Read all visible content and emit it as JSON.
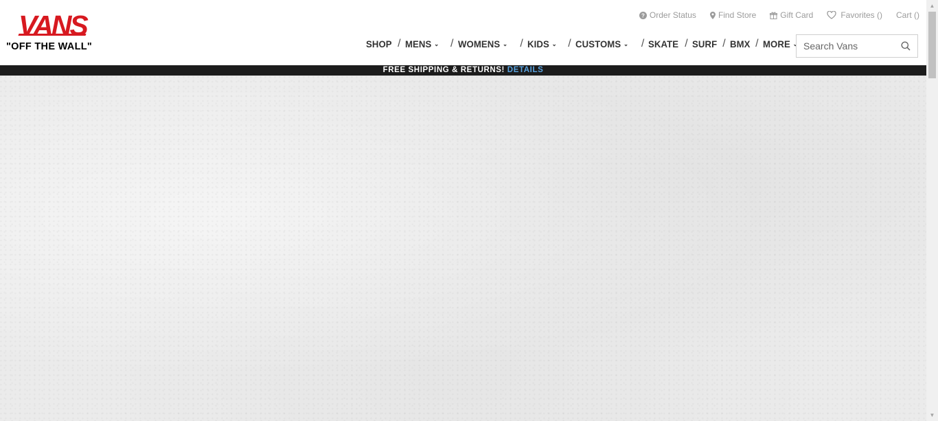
{
  "brand": {
    "name": "VANS",
    "tagline": "\"OFF THE WALL\"",
    "color": "#d71920"
  },
  "utility_nav": [
    {
      "label": "Order Status",
      "icon": "help-circle-icon"
    },
    {
      "label": "Find Store",
      "icon": "map-pin-icon"
    },
    {
      "label": "Gift Card",
      "icon": "gift-icon"
    },
    {
      "label": "Favorites ()",
      "icon": "heart-icon"
    },
    {
      "label": "Cart ()",
      "icon": null
    }
  ],
  "main_nav": [
    {
      "label": "SHOP",
      "dropdown": false
    },
    {
      "label": "MENS",
      "dropdown": true
    },
    {
      "label": "WOMENS",
      "dropdown": true
    },
    {
      "label": "KIDS",
      "dropdown": true
    },
    {
      "label": "CUSTOMS",
      "dropdown": true
    },
    {
      "label": "SKATE",
      "dropdown": false
    },
    {
      "label": "SURF",
      "dropdown": false
    },
    {
      "label": "BMX",
      "dropdown": false
    },
    {
      "label": "MORE",
      "dropdown": true
    }
  ],
  "search": {
    "placeholder": "Search Vans",
    "value": ""
  },
  "promo": {
    "text": "FREE SHIPPING & RETURNS!",
    "link": "DETAILS",
    "link_color": "#5aa3e0"
  },
  "colors": {
    "promo_bg": "#1c1c1c",
    "hero_bg": "#ebebeb"
  }
}
